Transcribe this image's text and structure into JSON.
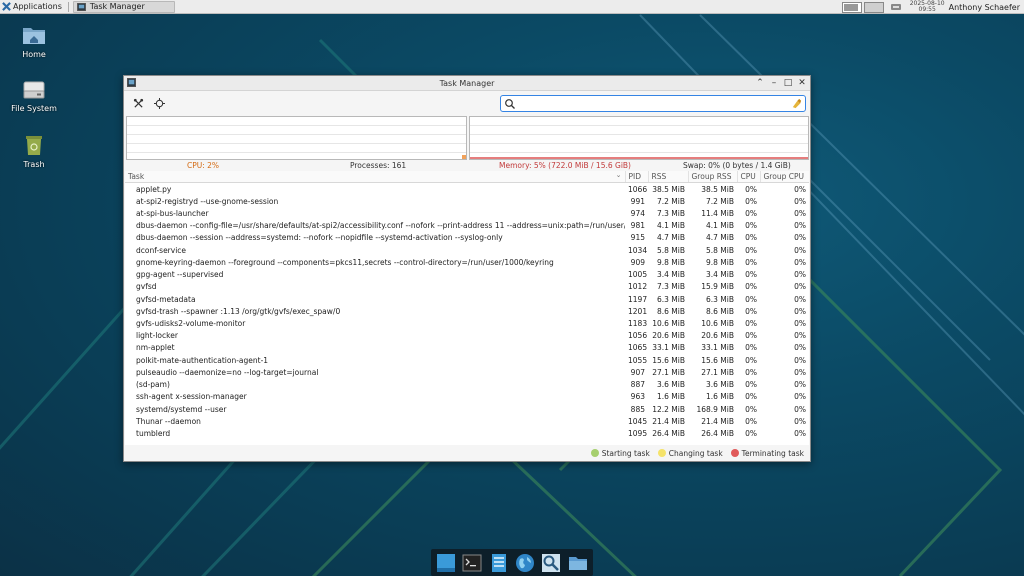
{
  "top_panel": {
    "applications_label": "Applications",
    "task_button_label": "Task Manager",
    "clock_date": "2025-08-10",
    "clock_time": "09:55",
    "username": "Anthony Schaefer"
  },
  "desktop": {
    "icons": [
      {
        "label": "Home"
      },
      {
        "label": "File System"
      },
      {
        "label": "Trash"
      }
    ]
  },
  "window": {
    "title": "Task Manager",
    "search": {
      "value": "",
      "placeholder": ""
    },
    "stats": {
      "cpu": "CPU: 2%",
      "processes": "Processes: 161",
      "memory": "Memory: 5% (722.0 MiB / 15.6 GiB)",
      "swap": "Swap: 0% (0 bytes / 1.4 GiB)"
    },
    "columns": [
      "Task",
      "PID",
      "RSS",
      "Group RSS",
      "CPU",
      "Group CPU"
    ],
    "rows": [
      [
        "applet.py",
        "1066",
        "38.5 MiB",
        "38.5 MiB",
        "0%",
        "0%"
      ],
      [
        "at-spi2-registryd --use-gnome-session",
        "991",
        "7.2 MiB",
        "7.2 MiB",
        "0%",
        "0%"
      ],
      [
        "at-spi-bus-launcher",
        "974",
        "7.3 MiB",
        "11.4 MiB",
        "0%",
        "0%"
      ],
      [
        "dbus-daemon --config-file=/usr/share/defaults/at-spi2/accessibility.conf --nofork --print-address 11 --address=unix:path=/run/user/1000/at...",
        "981",
        "4.1 MiB",
        "4.1 MiB",
        "0%",
        "0%"
      ],
      [
        "dbus-daemon --session --address=systemd: --nofork --nopidfile --systemd-activation --syslog-only",
        "915",
        "4.7 MiB",
        "4.7 MiB",
        "0%",
        "0%"
      ],
      [
        "dconf-service",
        "1034",
        "5.8 MiB",
        "5.8 MiB",
        "0%",
        "0%"
      ],
      [
        "gnome-keyring-daemon --foreground --components=pkcs11,secrets --control-directory=/run/user/1000/keyring",
        "909",
        "9.8 MiB",
        "9.8 MiB",
        "0%",
        "0%"
      ],
      [
        "gpg-agent --supervised",
        "1005",
        "3.4 MiB",
        "3.4 MiB",
        "0%",
        "0%"
      ],
      [
        "gvfsd",
        "1012",
        "7.3 MiB",
        "15.9 MiB",
        "0%",
        "0%"
      ],
      [
        "gvfsd-metadata",
        "1197",
        "6.3 MiB",
        "6.3 MiB",
        "0%",
        "0%"
      ],
      [
        "gvfsd-trash --spawner :1.13 /org/gtk/gvfs/exec_spaw/0",
        "1201",
        "8.6 MiB",
        "8.6 MiB",
        "0%",
        "0%"
      ],
      [
        "gvfs-udisks2-volume-monitor",
        "1183",
        "10.6 MiB",
        "10.6 MiB",
        "0%",
        "0%"
      ],
      [
        "light-locker",
        "1056",
        "20.6 MiB",
        "20.6 MiB",
        "0%",
        "0%"
      ],
      [
        "nm-applet",
        "1065",
        "33.1 MiB",
        "33.1 MiB",
        "0%",
        "0%"
      ],
      [
        "polkit-mate-authentication-agent-1",
        "1055",
        "15.6 MiB",
        "15.6 MiB",
        "0%",
        "0%"
      ],
      [
        "pulseaudio --daemonize=no --log-target=journal",
        "907",
        "27.1 MiB",
        "27.1 MiB",
        "0%",
        "0%"
      ],
      [
        "(sd-pam)",
        "887",
        "3.6 MiB",
        "3.6 MiB",
        "0%",
        "0%"
      ],
      [
        "ssh-agent x-session-manager",
        "963",
        "1.6 MiB",
        "1.6 MiB",
        "0%",
        "0%"
      ],
      [
        "systemd/systemd --user",
        "885",
        "12.2 MiB",
        "168.9 MiB",
        "0%",
        "0%"
      ],
      [
        "Thunar --daemon",
        "1045",
        "21.4 MiB",
        "21.4 MiB",
        "0%",
        "0%"
      ],
      [
        "tumblerd",
        "1095",
        "26.4 MiB",
        "26.4 MiB",
        "0%",
        "0%"
      ]
    ],
    "legend": {
      "starting": "Starting task",
      "changing": "Changing task",
      "terminating": "Terminating task"
    },
    "colors": {
      "starting": "#a6cf6e",
      "changing": "#f5e36a",
      "terminating": "#e05a5a",
      "accent": "#3584e4"
    }
  },
  "dock": {
    "items": [
      "desktop-icon",
      "terminal-icon",
      "file-manager-icon",
      "browser-icon",
      "search-icon",
      "folder-icon"
    ]
  }
}
